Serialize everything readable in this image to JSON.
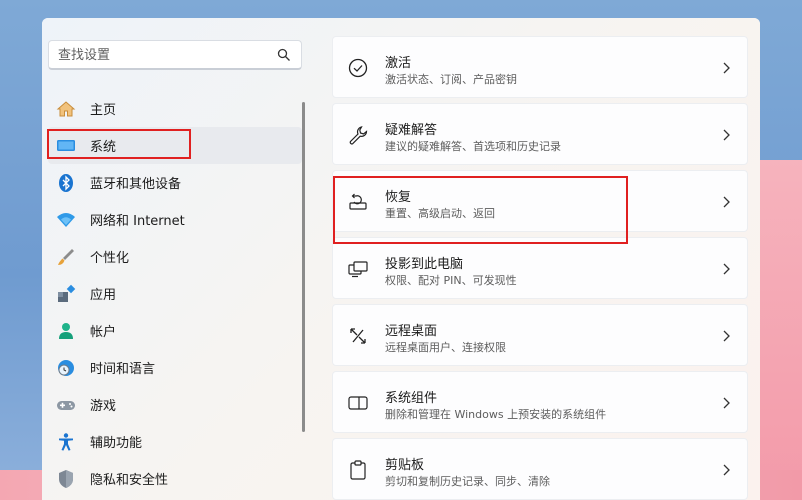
{
  "search": {
    "placeholder": "查找设置"
  },
  "nav": [
    {
      "label": "主页",
      "icon": "home-icon"
    },
    {
      "label": "系统",
      "icon": "monitor-icon",
      "active": true
    },
    {
      "label": "蓝牙和其他设备",
      "icon": "bluetooth-icon"
    },
    {
      "label": "网络和 Internet",
      "icon": "wifi-icon"
    },
    {
      "label": "个性化",
      "icon": "brush-icon"
    },
    {
      "label": "应用",
      "icon": "apps-icon"
    },
    {
      "label": "帐户",
      "icon": "person-icon"
    },
    {
      "label": "时间和语言",
      "icon": "clock-globe-icon"
    },
    {
      "label": "游戏",
      "icon": "gamepad-icon"
    },
    {
      "label": "辅助功能",
      "icon": "accessibility-icon"
    },
    {
      "label": "隐私和安全性",
      "icon": "shield-icon"
    }
  ],
  "cards": [
    {
      "title": "激活",
      "subtitle": "激活状态、订阅、产品密钥",
      "icon": "check-circle-icon"
    },
    {
      "title": "疑难解答",
      "subtitle": "建议的疑难解答、首选项和历史记录",
      "icon": "wrench-icon"
    },
    {
      "title": "恢复",
      "subtitle": "重置、高级启动、返回",
      "icon": "recovery-icon"
    },
    {
      "title": "投影到此电脑",
      "subtitle": "权限、配对 PIN、可发现性",
      "icon": "projection-icon"
    },
    {
      "title": "远程桌面",
      "subtitle": "远程桌面用户、连接权限",
      "icon": "remote-desktop-icon"
    },
    {
      "title": "系统组件",
      "subtitle": "删除和管理在 Windows 上预安装的系统组件",
      "icon": "system-components-icon"
    },
    {
      "title": "剪贴板",
      "subtitle": "剪切和复制历史记录、同步、清除",
      "icon": "clipboard-icon"
    }
  ],
  "colors": {
    "highlight": "#e02020",
    "accent": "#0067c0"
  }
}
